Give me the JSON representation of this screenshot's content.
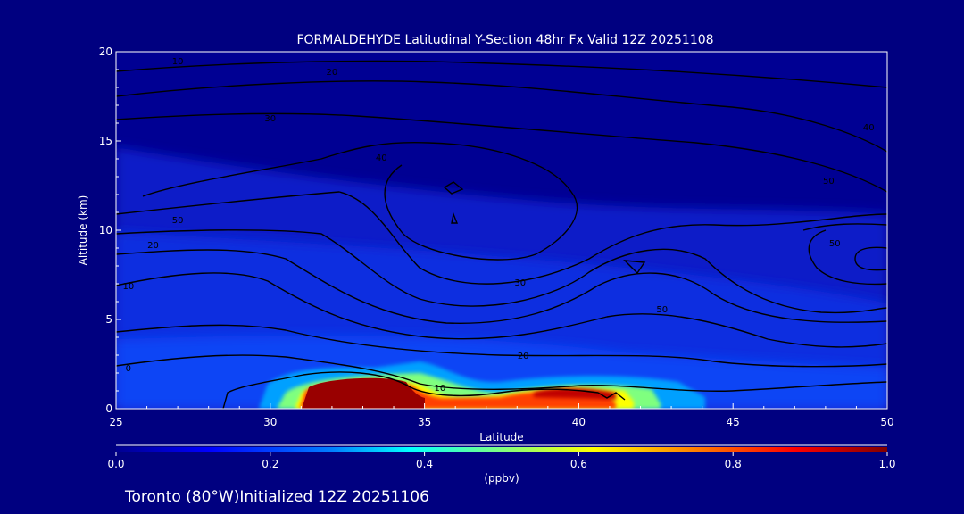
{
  "chart_data": {
    "type": "heatmap",
    "title": "FORMALDEHYDE Latitudinal Y-Section 48hr  Fx Valid 12Z 20251108",
    "xlabel": "Latitude",
    "ylabel": "Altitude (km)",
    "xlim": [
      25,
      50
    ],
    "ylim": [
      0,
      20
    ],
    "x_ticks": [
      "25",
      "30",
      "35",
      "40",
      "45",
      "50"
    ],
    "y_ticks": [
      "0",
      "5",
      "10",
      "15",
      "20"
    ],
    "colorbar": {
      "label": "(ppbv)",
      "range": [
        0.0,
        1.0
      ],
      "ticks": [
        "0.0",
        "0.2",
        "0.4",
        "0.6",
        "0.8",
        "1.0"
      ]
    },
    "contour_labels": [
      {
        "text": "10",
        "lat": 27.0,
        "alt": 19.5
      },
      {
        "text": "20",
        "lat": 32.0,
        "alt": 18.9
      },
      {
        "text": "30",
        "lat": 30.0,
        "alt": 16.3
      },
      {
        "text": "40",
        "lat": 33.6,
        "alt": 14.1
      },
      {
        "text": "50",
        "lat": 48.1,
        "alt": 12.8
      },
      {
        "text": "50",
        "lat": 27.0,
        "alt": 10.6
      },
      {
        "text": "20",
        "lat": 26.2,
        "alt": 9.2
      },
      {
        "text": "10",
        "lat": 25.4,
        "alt": 6.9
      },
      {
        "text": "50",
        "lat": 42.7,
        "alt": 5.6
      },
      {
        "text": "30",
        "lat": 38.1,
        "alt": 7.1
      },
      {
        "text": "20",
        "lat": 38.2,
        "alt": 3.0
      },
      {
        "text": "10",
        "lat": 35.5,
        "alt": 1.2
      },
      {
        "text": "0",
        "lat": 25.4,
        "alt": 2.3
      },
      {
        "text": "50",
        "lat": 48.3,
        "alt": 9.3
      },
      {
        "text": "40",
        "lat": 49.4,
        "alt": 15.8
      }
    ],
    "high_values": [
      {
        "lat_range": [
          31.2,
          35.2
        ],
        "alt_range": [
          0,
          1.6
        ],
        "value": 1.0
      },
      {
        "lat_range": [
          38.0,
          42.0
        ],
        "alt_range": [
          0.4,
          1.3
        ],
        "value": 0.85
      },
      {
        "lat_range": [
          34.5,
          37.5
        ],
        "alt_range": [
          0,
          2.5
        ],
        "value": 0.45
      },
      {
        "lat_range": [
          30.0,
          31.5
        ],
        "alt_range": [
          0,
          1.5
        ],
        "value": 0.35
      },
      {
        "lat_range": [
          41.5,
          44.0
        ],
        "alt_range": [
          0.5,
          1.6
        ],
        "value": 0.4
      }
    ]
  },
  "footer": {
    "text": "Toronto (80°W)Initialized 12Z 20251106"
  },
  "colors": {
    "background": "#000080",
    "axes": "#ffffff",
    "contour": "#000000",
    "colormap": [
      "#00008f",
      "#0000ff",
      "#007fff",
      "#00ffff",
      "#7fff7f",
      "#ffff00",
      "#ff7f00",
      "#ff0000",
      "#800000"
    ]
  }
}
